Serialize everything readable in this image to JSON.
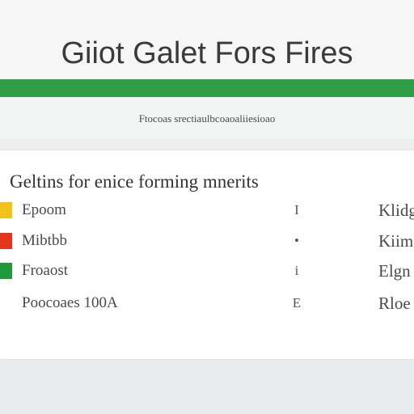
{
  "header": {
    "title": "Giiot Galet Fors Fires",
    "subtitle": "Ftocoas srectiaulbcoaoaliiesioao"
  },
  "theme": {
    "accent": "#2e9e45",
    "background": "#eceeef"
  },
  "card": {
    "heading": "Geltins for enice forming mnerits",
    "rows": [
      {
        "color": "#f2c21b",
        "label": "Epoom",
        "middle": "I",
        "right": "Klidg"
      },
      {
        "color": "#e5351f",
        "label": "Mibtbb",
        "middle": "•",
        "right": "Kiimo"
      },
      {
        "color": "#1e9a3b",
        "label": "Froaost",
        "middle": "i",
        "right": "Elgn"
      },
      {
        "color": "",
        "label": "Poocoaes 100A",
        "middle": "E",
        "right": "Rloe"
      }
    ]
  }
}
